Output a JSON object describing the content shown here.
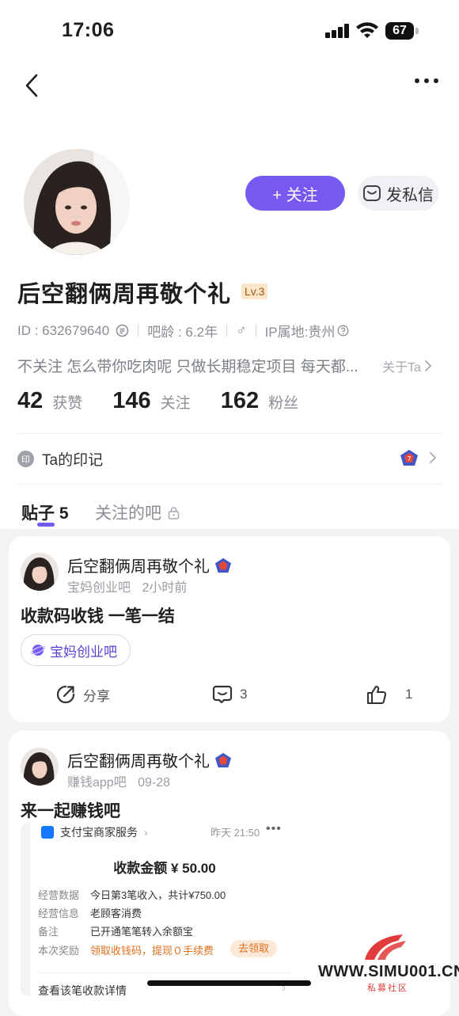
{
  "status_bar": {
    "time": "17:06",
    "battery": "67"
  },
  "profile": {
    "username": "后空翻俩周再敬个礼",
    "level": "Lv.3",
    "follow_label": "+ 关注",
    "message_label": "发私信",
    "id_text": "ID : 632679640",
    "bar_age": "吧龄 : 6.2年",
    "gender_symbol": "♂",
    "ip_location": "IP属地:贵州",
    "bio": "不关注 怎么带你吃肉呢 只做长期稳定项目 每天都...",
    "about_label": "关于Ta",
    "stats": [
      {
        "num": "42",
        "label": "获赞"
      },
      {
        "num": "146",
        "label": "关注"
      },
      {
        "num": "162",
        "label": "粉丝"
      }
    ],
    "mark_icon_text": "印",
    "mark_label": "Ta的印记"
  },
  "tabs": {
    "posts_label": "贴子 5",
    "followed_bars_label": "关注的吧"
  },
  "posts": [
    {
      "author": "后空翻俩周再敬个礼",
      "forum": "宝妈创业吧",
      "time": "2小时前",
      "title": "收款码收钱 一笔一结",
      "chip": "宝妈创业吧",
      "share_label": "分享",
      "comments": "3",
      "likes": "1"
    },
    {
      "author": "后空翻俩周再敬个礼",
      "forum": "赚钱app吧",
      "time": "09-28",
      "title": "来一起赚钱吧"
    }
  ],
  "embedded_screenshot": {
    "header": "支付宝商家服务",
    "header_time": "昨天 21:50",
    "amount_line": "收款金额 ¥ 50.00",
    "rows": [
      {
        "label": "经营数据",
        "value": "今日第3笔收入，共计¥750.00"
      },
      {
        "label": "经营信息",
        "value": "老顾客消费"
      },
      {
        "label": "备注",
        "value": "已开通笔笔转入余额宝"
      },
      {
        "label": "本次奖励",
        "value": "领取收钱码，提现０手续费"
      }
    ],
    "claim_label": "去领取",
    "footer": "查看该笔收款详情"
  },
  "watermark": {
    "site": "WWW.SIMU001.CN",
    "caption": "私募社区"
  },
  "colors": {
    "accent": "#7559f0",
    "reward_orange": "#e0701e"
  }
}
